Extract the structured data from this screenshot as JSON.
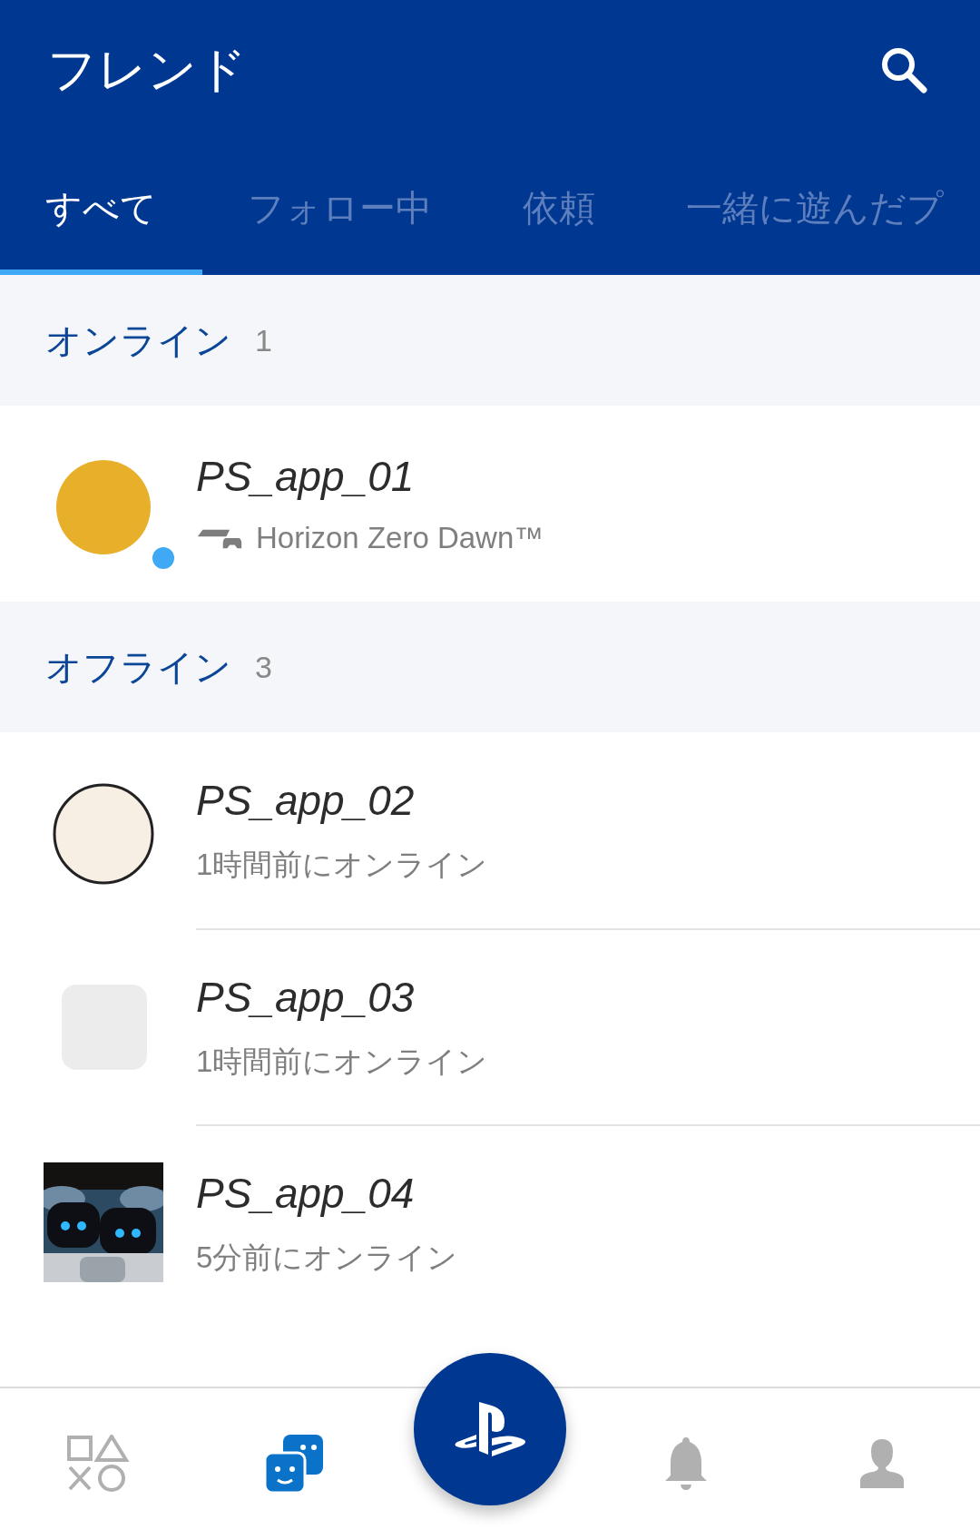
{
  "header": {
    "title": "フレンド"
  },
  "tabs": [
    {
      "label": "すべて",
      "selected": true
    },
    {
      "label": "フォロー中",
      "selected": false
    },
    {
      "label": "依頼",
      "selected": false
    },
    {
      "label": "一緒に遊んだプ",
      "selected": false
    }
  ],
  "sections": [
    {
      "title": "オンライン",
      "count": "1",
      "friends": [
        {
          "name": "PS_app_01",
          "status": "Horizon Zero Dawn™",
          "online": true,
          "playing": true,
          "avatar": {
            "kind": "circle",
            "color": "#e8b02a"
          }
        }
      ]
    },
    {
      "title": "オフライン",
      "count": "3",
      "friends": [
        {
          "name": "PS_app_02",
          "status": "1時間前にオンライン",
          "online": false,
          "playing": false,
          "avatar": {
            "kind": "outlined",
            "color": "#f8efe4"
          }
        },
        {
          "name": "PS_app_03",
          "status": "1時間前にオンライン",
          "online": false,
          "playing": false,
          "avatar": {
            "kind": "tile",
            "color": "#ececec"
          }
        },
        {
          "name": "PS_app_04",
          "status": "5分前にオンライン",
          "online": false,
          "playing": false
        }
      ]
    }
  ],
  "nav": [
    {
      "selected": false
    },
    {
      "selected": true
    },
    {
      "selected": false
    },
    {
      "selected": false
    }
  ]
}
